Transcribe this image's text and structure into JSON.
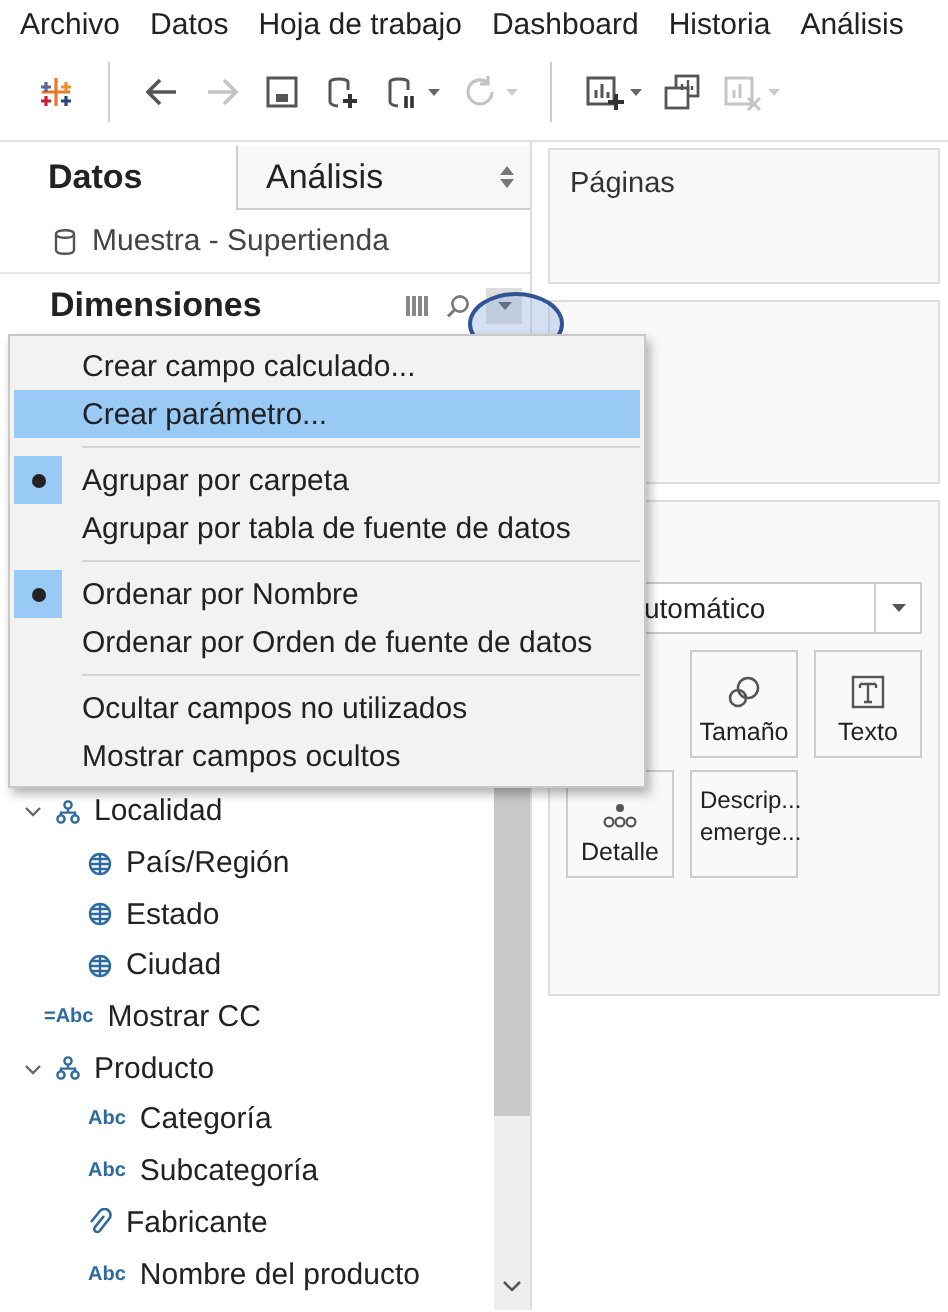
{
  "menubar": [
    "Archivo",
    "Datos",
    "Hoja de trabajo",
    "Dashboard",
    "Historia",
    "Análisis"
  ],
  "toolbar": [
    {
      "kind": "logo",
      "disabled": false
    },
    {
      "kind": "back",
      "disabled": false
    },
    {
      "kind": "forward",
      "disabled": true
    },
    {
      "kind": "save",
      "disabled": false
    },
    {
      "kind": "new-source",
      "disabled": false
    },
    {
      "kind": "pause-source",
      "disabled": false
    },
    {
      "kind": "refresh",
      "disabled": true
    },
    {
      "kind": "new-sheet",
      "disabled": false
    },
    {
      "kind": "duplicate",
      "disabled": false
    },
    {
      "kind": "clear",
      "disabled": true
    }
  ],
  "data_pane": {
    "tabs": [
      {
        "label": "Datos",
        "selected": true
      },
      {
        "label": "Análisis",
        "selected": false
      }
    ],
    "source": "Muestra - Supertienda",
    "section_title": "Dimensiones",
    "tree": [
      {
        "label": "Localidad",
        "kind": "hierarchy",
        "expanded": true,
        "children": [
          {
            "label": "País/Región",
            "kind": "geo"
          },
          {
            "label": "Estado",
            "kind": "geo"
          },
          {
            "label": "Ciudad",
            "kind": "geo"
          }
        ]
      },
      {
        "label": "Mostrar CC",
        "kind": "text",
        "type_label": "=Abc"
      },
      {
        "label": "Producto",
        "kind": "hierarchy",
        "expanded": true,
        "children": [
          {
            "label": "Categoría",
            "kind": "text",
            "type_label": "Abc"
          },
          {
            "label": "Subcategoría",
            "kind": "text",
            "type_label": "Abc"
          },
          {
            "label": "Fabricante",
            "kind": "group"
          },
          {
            "label": "Nombre del producto",
            "kind": "text",
            "type_label": "Abc"
          }
        ]
      }
    ]
  },
  "context_menu": {
    "groups": [
      [
        {
          "label": "Crear campo calculado...",
          "selected": false,
          "checked": false
        },
        {
          "label": "Crear parámetro...",
          "selected": true,
          "checked": false
        }
      ],
      [
        {
          "label": "Agrupar por carpeta",
          "selected": false,
          "checked": true
        },
        {
          "label": "Agrupar por tabla de fuente de datos",
          "selected": false,
          "checked": false
        }
      ],
      [
        {
          "label": "Ordenar por Nombre",
          "selected": false,
          "checked": true
        },
        {
          "label": "Ordenar por Orden de fuente de datos",
          "selected": false,
          "checked": false
        }
      ],
      [
        {
          "label": "Ocultar campos no utilizados",
          "selected": false,
          "checked": false
        },
        {
          "label": "Mostrar campos ocultos",
          "selected": false,
          "checked": false
        }
      ]
    ]
  },
  "pages_card": {
    "title": "Páginas"
  },
  "marks_card": {
    "mark_type": "utomático",
    "buttons": [
      {
        "kind": "size",
        "lines": [
          "Tamaño"
        ]
      },
      {
        "kind": "text",
        "lines": [
          "Texto"
        ]
      },
      {
        "kind": "detail",
        "lines": [
          "Detalle"
        ]
      },
      {
        "kind": "tooltip",
        "lines": [
          "Descrip...",
          "emerge..."
        ]
      }
    ]
  }
}
